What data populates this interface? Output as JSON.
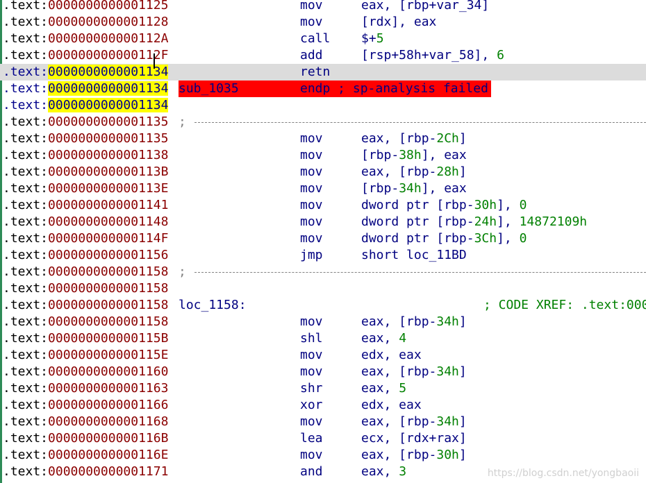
{
  "rows": [
    {
      "seg": ".text:",
      "off": "0000000000001125",
      "mnem": "mov",
      "ops": [
        {
          "t": "eax, [rbp+var_34]"
        }
      ]
    },
    {
      "seg": ".text:",
      "off": "0000000000001128",
      "mnem": "mov",
      "ops": [
        {
          "t": "[rdx], eax"
        }
      ]
    },
    {
      "seg": ".text:",
      "off": "000000000000112A",
      "mnem": "call",
      "ops": [
        {
          "t": "$+"
        },
        {
          "t": "5",
          "num": true
        }
      ]
    },
    {
      "seg": ".text:",
      "off": "000000000000112F",
      "mnem": "add",
      "ops": [
        {
          "t": "[rsp+58h+var_58], "
        },
        {
          "t": "6",
          "num": true
        }
      ]
    },
    {
      "seg": ".text:",
      "off": "0000000000001134",
      "mnem": "retn",
      "ops": [],
      "current": true,
      "sel": true
    },
    {
      "seg": ".text:",
      "off": "0000000000001134",
      "error_label": "sub_1035",
      "error_text": "endp ; sp-analysis failed",
      "sel": true
    },
    {
      "seg": ".text:",
      "off": "0000000000001134",
      "sel": true
    },
    {
      "seg": ".text:",
      "off": "0000000000001135",
      "separator": ";"
    },
    {
      "seg": ".text:",
      "off": "0000000000001135",
      "mnem": "mov",
      "ops": [
        {
          "t": "eax, [rbp-"
        },
        {
          "t": "2Ch",
          "num": true
        },
        {
          "t": "]"
        }
      ]
    },
    {
      "seg": ".text:",
      "off": "0000000000001138",
      "mnem": "mov",
      "ops": [
        {
          "t": "[rbp-"
        },
        {
          "t": "38h",
          "num": true
        },
        {
          "t": "], eax"
        }
      ]
    },
    {
      "seg": ".text:",
      "off": "000000000000113B",
      "mnem": "mov",
      "ops": [
        {
          "t": "eax, [rbp-"
        },
        {
          "t": "28h",
          "num": true
        },
        {
          "t": "]"
        }
      ]
    },
    {
      "seg": ".text:",
      "off": "000000000000113E",
      "mnem": "mov",
      "ops": [
        {
          "t": "[rbp-"
        },
        {
          "t": "34h",
          "num": true
        },
        {
          "t": "], eax"
        }
      ]
    },
    {
      "seg": ".text:",
      "off": "0000000000001141",
      "mnem": "mov",
      "ops": [
        {
          "t": "dword ptr [rbp-"
        },
        {
          "t": "30h",
          "num": true
        },
        {
          "t": "], "
        },
        {
          "t": "0",
          "num": true
        }
      ]
    },
    {
      "seg": ".text:",
      "off": "0000000000001148",
      "mnem": "mov",
      "ops": [
        {
          "t": "dword ptr [rbp-"
        },
        {
          "t": "24h",
          "num": true
        },
        {
          "t": "], "
        },
        {
          "t": "14872109h",
          "num": true
        }
      ]
    },
    {
      "seg": ".text:",
      "off": "000000000000114F",
      "mnem": "mov",
      "ops": [
        {
          "t": "dword ptr [rbp-"
        },
        {
          "t": "3Ch",
          "num": true
        },
        {
          "t": "], "
        },
        {
          "t": "0",
          "num": true
        }
      ]
    },
    {
      "seg": ".text:",
      "off": "0000000000001156",
      "mnem": "jmp",
      "ops": [
        {
          "t": "short loc_11BD"
        }
      ]
    },
    {
      "seg": ".text:",
      "off": "0000000000001158",
      "separator": ";"
    },
    {
      "seg": ".text:",
      "off": "0000000000001158"
    },
    {
      "seg": ".text:",
      "off": "0000000000001158",
      "label": "loc_1158:",
      "comment": "; CODE XREF: .text:000"
    },
    {
      "seg": ".text:",
      "off": "0000000000001158",
      "mnem": "mov",
      "ops": [
        {
          "t": "eax, [rbp-"
        },
        {
          "t": "34h",
          "num": true
        },
        {
          "t": "]"
        }
      ]
    },
    {
      "seg": ".text:",
      "off": "000000000000115B",
      "mnem": "shl",
      "ops": [
        {
          "t": "eax, "
        },
        {
          "t": "4",
          "num": true
        }
      ]
    },
    {
      "seg": ".text:",
      "off": "000000000000115E",
      "mnem": "mov",
      "ops": [
        {
          "t": "edx, eax"
        }
      ]
    },
    {
      "seg": ".text:",
      "off": "0000000000001160",
      "mnem": "mov",
      "ops": [
        {
          "t": "eax, [rbp-"
        },
        {
          "t": "34h",
          "num": true
        },
        {
          "t": "]"
        }
      ]
    },
    {
      "seg": ".text:",
      "off": "0000000000001163",
      "mnem": "shr",
      "ops": [
        {
          "t": "eax, "
        },
        {
          "t": "5",
          "num": true
        }
      ]
    },
    {
      "seg": ".text:",
      "off": "0000000000001166",
      "mnem": "xor",
      "ops": [
        {
          "t": "edx, eax"
        }
      ]
    },
    {
      "seg": ".text:",
      "off": "0000000000001168",
      "mnem": "mov",
      "ops": [
        {
          "t": "eax, [rbp-"
        },
        {
          "t": "34h",
          "num": true
        },
        {
          "t": "]"
        }
      ]
    },
    {
      "seg": ".text:",
      "off": "000000000000116B",
      "mnem": "lea",
      "ops": [
        {
          "t": "ecx, [rdx+rax]"
        }
      ]
    },
    {
      "seg": ".text:",
      "off": "000000000000116E",
      "mnem": "mov",
      "ops": [
        {
          "t": "eax, [rbp-"
        },
        {
          "t": "30h",
          "num": true
        },
        {
          "t": "]"
        }
      ]
    },
    {
      "seg": ".text:",
      "off": "0000000000001171",
      "mnem": "and",
      "ops": [
        {
          "t": "eax, "
        },
        {
          "t": "3",
          "num": true
        }
      ]
    }
  ],
  "watermark": "https://blog.csdn.net/yongbaoii",
  "colors": {
    "address": "#8b0000",
    "code": "#000080",
    "number": "#008000",
    "selection": "#ffff00",
    "error": "#ff0000",
    "current_line": "#dcdcdc"
  }
}
